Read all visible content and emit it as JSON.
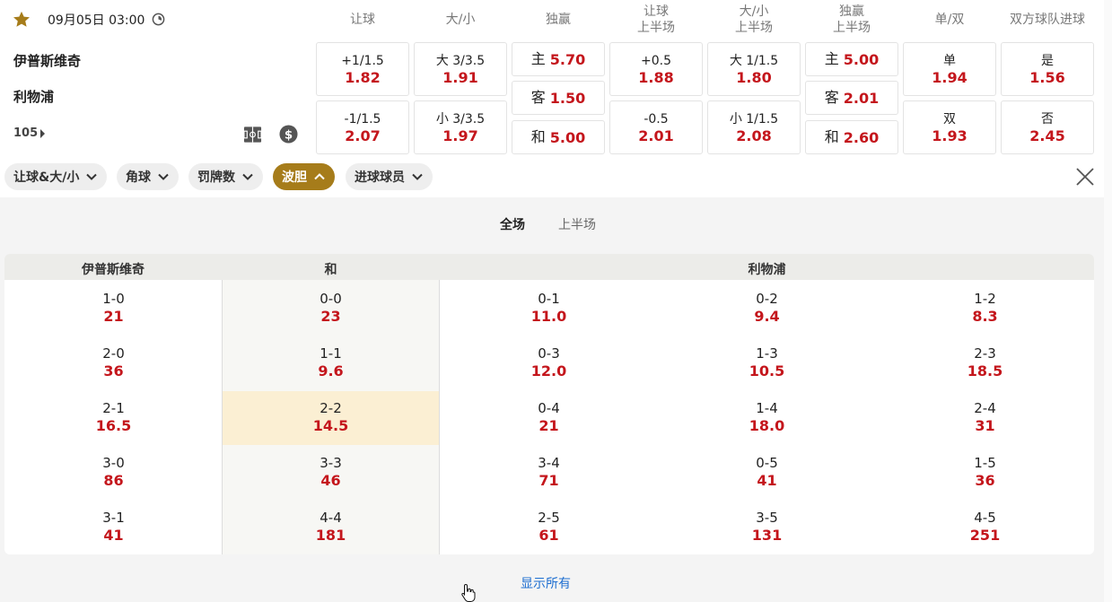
{
  "match": {
    "datetime": "09月05日 03:00",
    "home_team": "伊普斯维奇",
    "away_team": "利物浦",
    "more_markets_count": "105",
    "icons": [
      "star-icon",
      "clock-icon",
      "pitch-icon",
      "dollar-icon"
    ]
  },
  "market_headers": [
    {
      "l1": "让球",
      "l2": ""
    },
    {
      "l1": "大/小",
      "l2": ""
    },
    {
      "l1": "独赢",
      "l2": ""
    },
    {
      "l1": "让球",
      "l2": "上半场"
    },
    {
      "l1": "大/小",
      "l2": "上半场"
    },
    {
      "l1": "独赢",
      "l2": "上半场"
    },
    {
      "l1": "单/双",
      "l2": ""
    },
    {
      "l1": "双方球队进球",
      "l2": ""
    }
  ],
  "markets": {
    "handicap": [
      {
        "line": "+1/1.5",
        "price": "1.82"
      },
      {
        "line": "-1/1.5",
        "price": "2.07"
      }
    ],
    "over_under": [
      {
        "line": "大 3/3.5",
        "price": "1.91"
      },
      {
        "line": "小 3/3.5",
        "price": "1.97"
      }
    ],
    "moneyline": [
      {
        "line": "主",
        "price": "5.70"
      },
      {
        "line": "客",
        "price": "1.50"
      },
      {
        "line": "和",
        "price": "5.00"
      }
    ],
    "handicap_1h": [
      {
        "line": "+0.5",
        "price": "1.88"
      },
      {
        "line": "-0.5",
        "price": "2.01"
      }
    ],
    "over_under_1h": [
      {
        "line": "大 1/1.5",
        "price": "1.80"
      },
      {
        "line": "小 1/1.5",
        "price": "2.08"
      }
    ],
    "moneyline_1h": [
      {
        "line": "主",
        "price": "5.00"
      },
      {
        "line": "客",
        "price": "2.01"
      },
      {
        "line": "和",
        "price": "2.60"
      }
    ],
    "odd_even": [
      {
        "line": "单",
        "price": "1.94"
      },
      {
        "line": "双",
        "price": "1.93"
      }
    ],
    "btts": [
      {
        "line": "是",
        "price": "1.56"
      },
      {
        "line": "否",
        "price": "2.45"
      }
    ]
  },
  "filters": [
    {
      "label": "让球&大/小",
      "active": false
    },
    {
      "label": "角球",
      "active": false
    },
    {
      "label": "罚牌数",
      "active": false
    },
    {
      "label": "波胆",
      "active": true
    },
    {
      "label": "进球球员",
      "active": false
    }
  ],
  "correct_score": {
    "tabs": [
      {
        "label": "全场",
        "active": true
      },
      {
        "label": "上半场",
        "active": false
      }
    ],
    "headers": {
      "home": "伊普斯维奇",
      "draw": "和",
      "away": "利物浦"
    },
    "home": [
      {
        "score": "1-0",
        "price": "21"
      },
      {
        "score": "2-0",
        "price": "36"
      },
      {
        "score": "2-1",
        "price": "16.5"
      },
      {
        "score": "3-0",
        "price": "86"
      },
      {
        "score": "3-1",
        "price": "41"
      }
    ],
    "draw": [
      {
        "score": "0-0",
        "price": "23"
      },
      {
        "score": "1-1",
        "price": "9.6"
      },
      {
        "score": "2-2",
        "price": "14.5",
        "highlighted": true
      },
      {
        "score": "3-3",
        "price": "46"
      },
      {
        "score": "4-4",
        "price": "181"
      }
    ],
    "away_col1": [
      {
        "score": "0-1",
        "price": "11.0"
      },
      {
        "score": "0-3",
        "price": "12.0"
      },
      {
        "score": "0-4",
        "price": "21"
      },
      {
        "score": "3-4",
        "price": "71"
      },
      {
        "score": "2-5",
        "price": "61"
      }
    ],
    "away_col2": [
      {
        "score": "0-2",
        "price": "9.4"
      },
      {
        "score": "1-3",
        "price": "10.5"
      },
      {
        "score": "1-4",
        "price": "18.0"
      },
      {
        "score": "0-5",
        "price": "41"
      },
      {
        "score": "3-5",
        "price": "131"
      }
    ],
    "away_col3": [
      {
        "score": "1-2",
        "price": "8.3"
      },
      {
        "score": "2-3",
        "price": "18.5"
      },
      {
        "score": "2-4",
        "price": "31"
      },
      {
        "score": "1-5",
        "price": "36"
      },
      {
        "score": "4-5",
        "price": "251"
      }
    ],
    "show_all_label": "显示所有"
  },
  "colors": {
    "accent": "#a67c1a",
    "price": "#c4161c",
    "link": "#1f6fd1",
    "highlight": "#fbefd3"
  }
}
